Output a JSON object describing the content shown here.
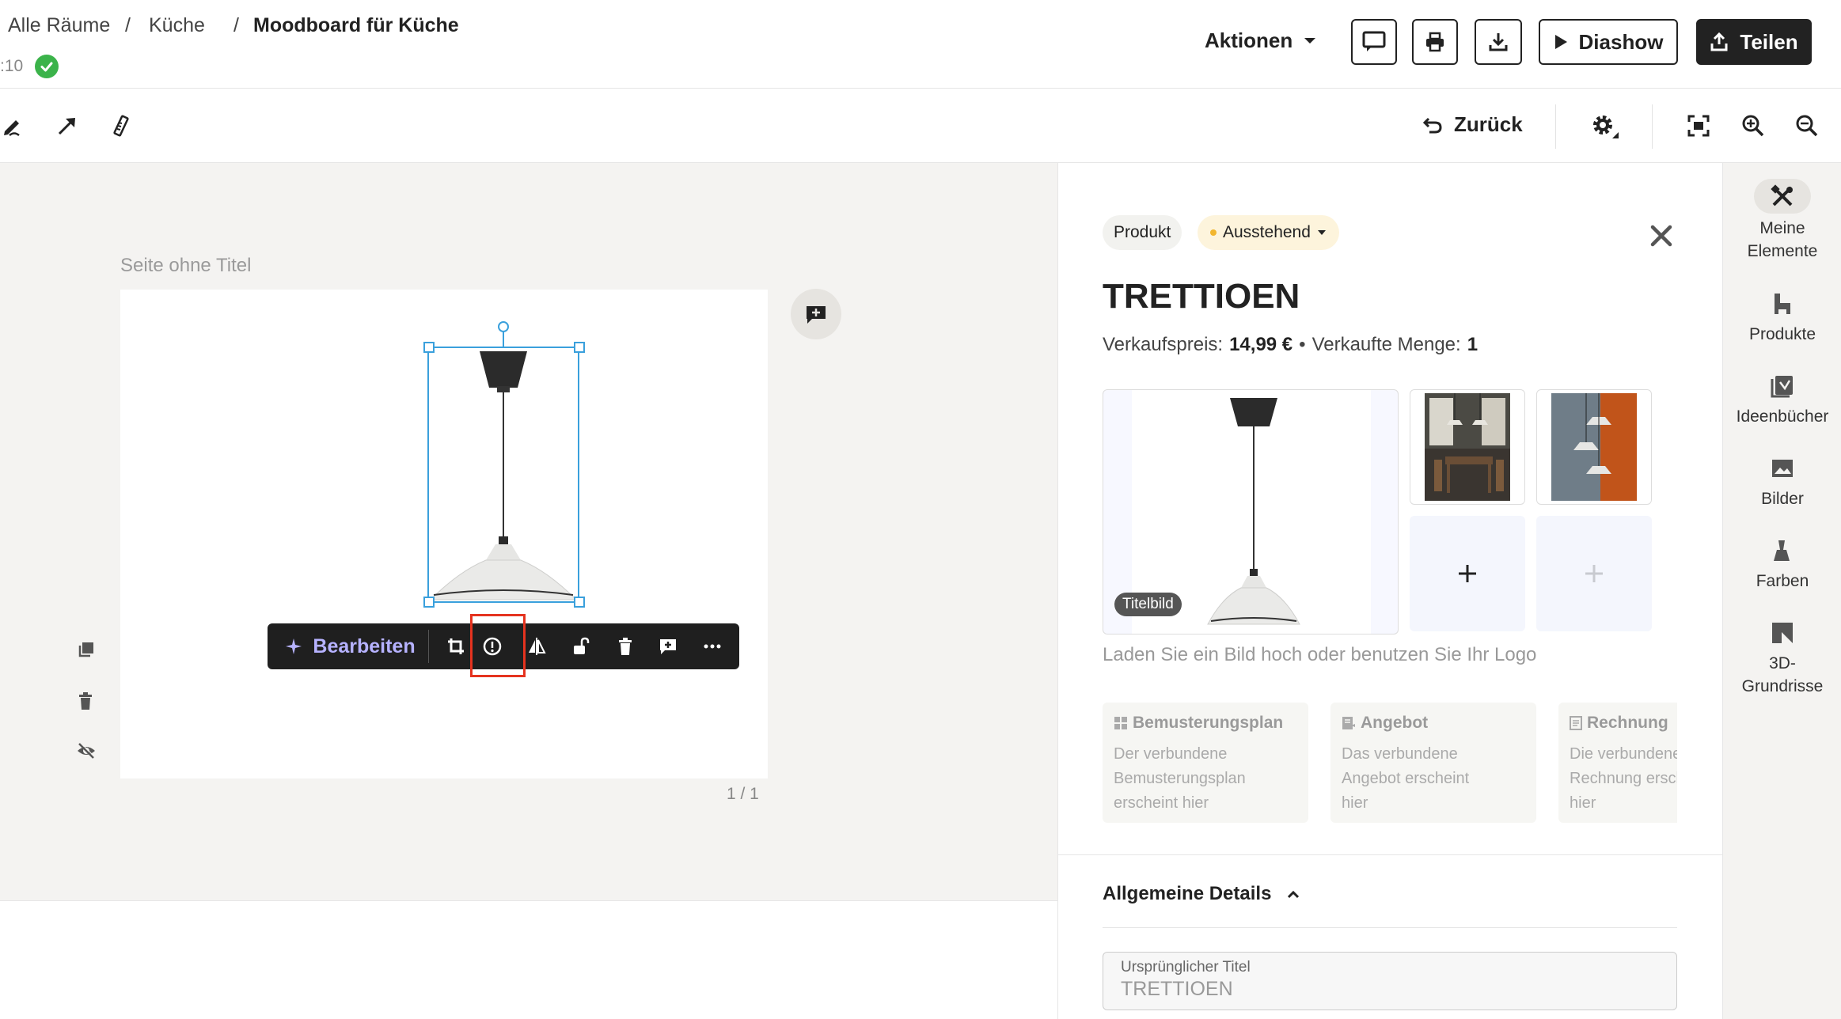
{
  "header": {
    "breadcrumb": [
      "Alle Räume",
      "Küche",
      "Moodboard für Küche"
    ],
    "separators": [
      "/",
      "/"
    ],
    "time_fragment": ":10",
    "actions_label": "Aktionen",
    "diashow_label": "Diashow",
    "share_label": "Teilen"
  },
  "toolbar": {
    "undo_label": "Zurück"
  },
  "canvas": {
    "page_title": "Seite ohne Titel",
    "page_counter": "1 / 1",
    "floating_toolbar": {
      "edit_label": "Bearbeiten"
    }
  },
  "panel": {
    "type_tag": "Produkt",
    "status_label": "Ausstehend",
    "status_color": "#f2b62e",
    "product_title": "TRETTIOEN",
    "price_label": "Verkaufspreis:",
    "price_value": "14,99 €",
    "bullet": "•",
    "qty_label": "Verkaufte Menge:",
    "qty_value": "1",
    "cover_badge": "Titelbild",
    "upload_hint": "Laden Sie ein Bild hoch oder benutzen Sie Ihr Logo",
    "cards": [
      {
        "title": "Bemusterungsplan",
        "desc": [
          "Der verbundene",
          "Bemusterungsplan",
          "erscheint hier"
        ]
      },
      {
        "title": "Angebot",
        "desc": [
          "Das verbundene",
          "Angebot erscheint",
          "hier"
        ]
      },
      {
        "title": "Rechnung",
        "desc": [
          "Die verbundene",
          "Rechnung erscheint",
          "hier"
        ]
      }
    ],
    "details_heading": "Allgemeine Details",
    "original_title_label": "Ursprünglicher Titel",
    "original_title_value": "TRETTIOEN"
  },
  "rail": {
    "items": [
      {
        "label1": "Meine",
        "label2": "Elemente",
        "icon": "my-elements-icon"
      },
      {
        "label1": "Produkte",
        "label2": "",
        "icon": "products-icon"
      },
      {
        "label1": "Ideenbücher",
        "label2": "",
        "icon": "ideabooks-icon"
      },
      {
        "label1": "Bilder",
        "label2": "",
        "icon": "images-icon"
      },
      {
        "label1": "Farben",
        "label2": "",
        "icon": "colors-icon"
      },
      {
        "label1": "3D-",
        "label2": "Grundrisse",
        "icon": "floorplans-icon"
      }
    ]
  },
  "colors": {
    "success": "#3bb34a",
    "selection": "#3aa0dc",
    "highlight": "#e5331f",
    "edit_accent": "#b6b2ff"
  }
}
